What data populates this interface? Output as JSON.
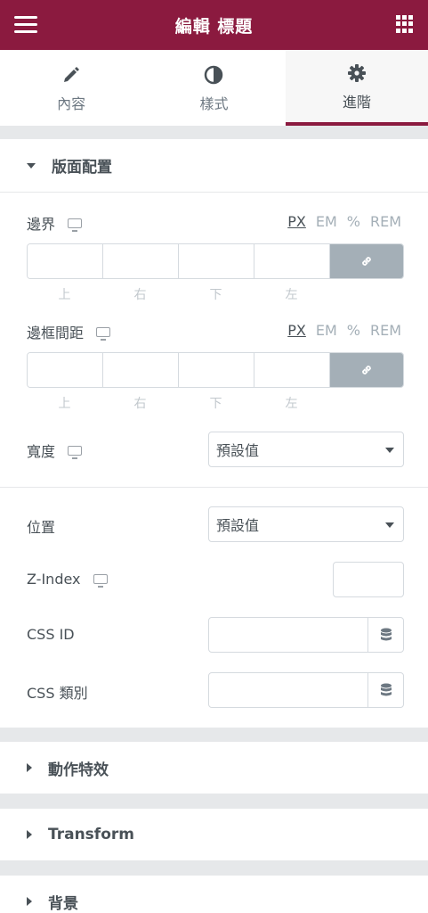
{
  "header": {
    "title": "編輯 標題"
  },
  "tabs": [
    {
      "label": "內容",
      "icon": "pencil-icon"
    },
    {
      "label": "樣式",
      "icon": "half-circle-icon"
    },
    {
      "label": "進階",
      "icon": "gear-icon",
      "active": true
    }
  ],
  "section": {
    "title": "版面配置",
    "margin": {
      "label": "邊界",
      "units": [
        "PX",
        "EM",
        "%",
        "REM"
      ],
      "active_unit": "PX",
      "sides": [
        "上",
        "右",
        "下",
        "左"
      ]
    },
    "padding": {
      "label": "邊框間距",
      "units": [
        "PX",
        "EM",
        "%",
        "REM"
      ],
      "active_unit": "PX",
      "sides": [
        "上",
        "右",
        "下",
        "左"
      ]
    },
    "width": {
      "label": "寬度",
      "value": "預設值"
    },
    "position": {
      "label": "位置",
      "value": "預設值"
    },
    "zindex": {
      "label": "Z-Index"
    },
    "cssid": {
      "label": "CSS ID"
    },
    "cssclass": {
      "label": "CSS 類別"
    }
  },
  "collapsed_sections": [
    "動作特效",
    "Transform",
    "背景"
  ],
  "colors": {
    "accent": "#8b1a3f",
    "link_button": "#a4afb7"
  }
}
